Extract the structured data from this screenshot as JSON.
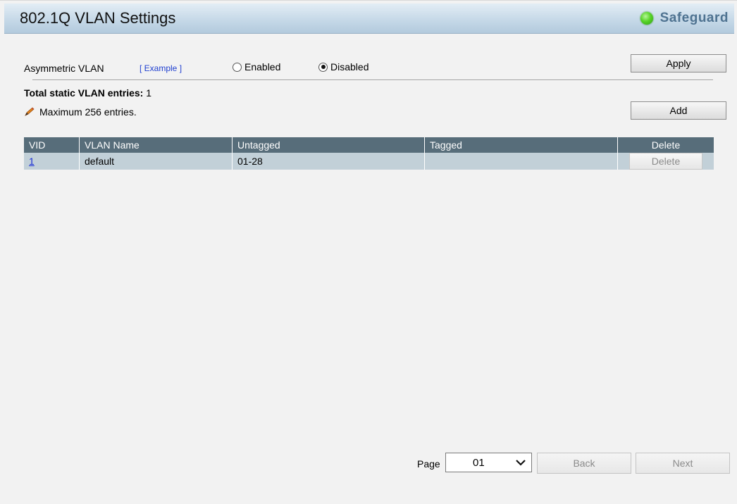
{
  "header": {
    "title": "802.1Q VLAN Settings",
    "safeguard_label": "Safeguard",
    "safeguard_status_color": "#4fd022"
  },
  "asymmetric": {
    "label": "Asymmetric VLAN",
    "example_link": "[ Example ]",
    "option_enabled": "Enabled",
    "option_disabled": "Disabled",
    "selected": "Disabled",
    "apply_label": "Apply"
  },
  "summary": {
    "total_label": "Total static VLAN entries:",
    "total_value": "1",
    "max_note": "Maximum 256 entries.",
    "add_label": "Add"
  },
  "table": {
    "columns": [
      "VID",
      "VLAN Name",
      "Untagged",
      "Tagged",
      "Delete"
    ],
    "rows": [
      {
        "vid": "1",
        "name": "default",
        "untagged": "01-28",
        "tagged": "",
        "delete_label": "Delete"
      }
    ],
    "header_color": "#576d7a",
    "row_color": "#c2d0d8"
  },
  "pager": {
    "page_label": "Page",
    "page_value": "01",
    "back_label": "Back",
    "next_label": "Next"
  }
}
